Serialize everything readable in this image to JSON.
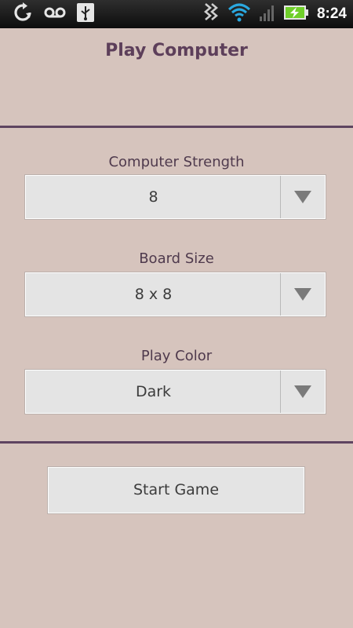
{
  "status_bar": {
    "time": "8:24",
    "icons": [
      "sync-icon",
      "voicemail-icon",
      "usb-icon",
      "vibrate-icon",
      "wifi-icon",
      "signal-icon",
      "battery-charging-icon"
    ]
  },
  "title": "Play Computer",
  "settings": {
    "strength": {
      "label": "Computer Strength",
      "value": "8"
    },
    "board_size": {
      "label": "Board Size",
      "value": "8 x 8"
    },
    "play_color": {
      "label": "Play Color",
      "value": "Dark"
    }
  },
  "start_button": {
    "label": "Start Game"
  },
  "colors": {
    "background": "#d6c4bd",
    "accent": "#5e4460",
    "title": "#5d3f5a"
  }
}
